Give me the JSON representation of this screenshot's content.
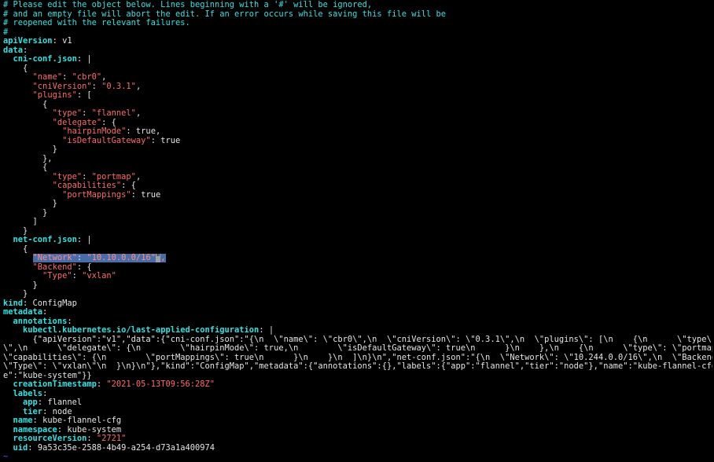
{
  "editor": {
    "comments": [
      "# Please edit the object below. Lines beginning with a '#' will be ignored,",
      "# and an empty file will abort the edit. If an error occurs while saving this file will be",
      "# reopened with the relevant failures.",
      "#"
    ],
    "api_key": "apiVersion",
    "api_val": "v1",
    "data_key": "data",
    "cni_key": "cni-conf.json",
    "pipe": "|",
    "brace_open": "{",
    "brace_close": "}",
    "brace_close_comma": "},",
    "bracket_close": "]",
    "name_key": "\"name\"",
    "name_val": "\"cbr0\"",
    "cniver_key": "\"cniVersion\"",
    "cniver_val": "\"0.3.1\"",
    "plugins_key": "\"plugins\"",
    "bracket_open": "[",
    "type_key": "\"type\"",
    "flannel_val": "\"flannel\"",
    "delegate_key": "\"delegate\"",
    "hairpin_key": "\"hairpinMode\"",
    "true_comma": "true,",
    "isdefault_key": "\"isDefaultGateway\"",
    "true_val": "true",
    "portmap_val": "\"portmap\"",
    "capabilities_key": "\"capabilities\"",
    "portmappings_key": "\"portMappings\"",
    "net_key": "net-conf.json",
    "network_key": "\"Network\"",
    "network_val": "\"10.10.0.0/16\"",
    "network_cursor": "\"",
    "network_comma": ",",
    "backend_key": "\"Backend\"",
    "type2_key": "\"Type\"",
    "vxlan_val": "\"vxlan\"",
    "kind_key": "kind",
    "kind_val": "ConfigMap",
    "metadata_key": "metadata",
    "annotations_key": "annotations",
    "lastapplied_key": "kubectl.kubernetes.io/last-applied-configuration",
    "json_lines": [
      "      {\"apiVersion\":\"v1\",\"data\":{\"cni-conf.json\":\"{\\n  \\\"name\\\": \\\"cbr0\\\",\\n  \\\"cniVersion\\\": \\\"0.3.1\\\",\\n  \\\"plugins\\\": [\\n    {\\n      \\\"type\\\": \\\"flannel",
      "\\\",\\n      \\\"delegate\\\": {\\n        \\\"hairpinMode\\\": true,\\n        \\\"isDefaultGateway\\\": true\\n      }\\n    },\\n    {\\n      \\\"type\\\": \\\"portmap\\\",\\n",
      "\\\"capabilities\\\": {\\n        \\\"portMappings\\\": true\\n      }\\n    }\\n  ]\\n}\\n\",\"net-conf.json\":\"{\\n  \\\"Network\\\": \\\"10.244.0.0/16\\\",\\n  \\\"Backend\\\": {\\n",
      "\\\"Type\\\": \\\"vxlan\\\"\\n  }\\n}\\n\"},\"kind\":\"ConfigMap\",\"metadata\":{\"annotations\":{},\"labels\":{\"app\":\"flannel\",\"tier\":\"node\"},\"name\":\"kube-flannel-cfg\",\"namespac",
      "e\":\"kube-system\"}}"
    ],
    "creation_key": "creationTimestamp",
    "creation_val": "\"2021-05-13T09:56:28Z\"",
    "labels_key": "labels",
    "app_key": "app",
    "app_val": "flannel",
    "tier_key": "tier",
    "tier_val": "node",
    "mname_key": "name",
    "mname_val": "kube-flannel-cfg",
    "namespace_key": "namespace",
    "namespace_val": "kube-system",
    "resver_key": "resourceVersion",
    "resver_val": "\"2721\"",
    "uid_key": "uid",
    "uid_val": "9a53c35e-2588-4b49-a254-d73a1a400974",
    "tilde": "~"
  },
  "colors": {
    "background": "#000000",
    "comment": "#2de3e3",
    "key": "#2de3e3",
    "string": "#ff6b6b",
    "text": "#e6e6e6",
    "selection": "#4a6da8"
  }
}
